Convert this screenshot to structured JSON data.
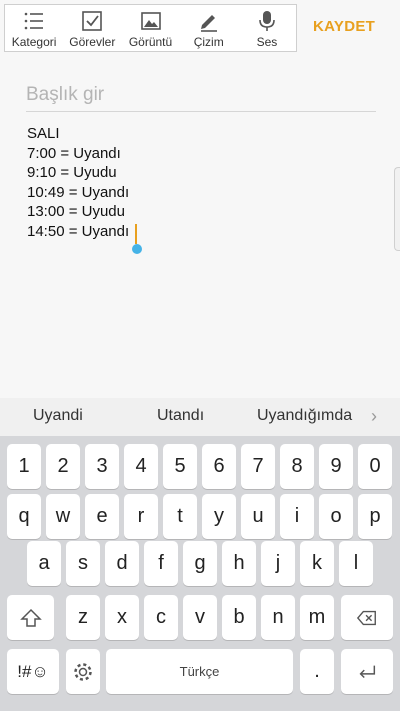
{
  "toolbar": {
    "items": [
      {
        "label": "Kategori",
        "icon": "category-list-icon"
      },
      {
        "label": "Görevler",
        "icon": "checkbox-icon"
      },
      {
        "label": "Görüntü",
        "icon": "image-icon"
      },
      {
        "label": "Çizim",
        "icon": "pen-icon"
      },
      {
        "label": "Ses",
        "icon": "microphone-icon"
      }
    ],
    "save_label": "KAYDET"
  },
  "editor": {
    "title_placeholder": "Başlık gir",
    "body_lines": [
      "SALI",
      "7:00 = Uyandı",
      "9:10 = Uyudu",
      "10:49 = Uyandı",
      "13:00 = Uyudu",
      "14:50 = Uyandı"
    ]
  },
  "suggestions": [
    "Uyandi",
    "Utandı",
    "Uyandığımda"
  ],
  "keyboard": {
    "row_numbers": [
      "1",
      "2",
      "3",
      "4",
      "5",
      "6",
      "7",
      "8",
      "9",
      "0"
    ],
    "row_top": [
      "q",
      "w",
      "e",
      "r",
      "t",
      "y",
      "u",
      "i",
      "o",
      "p"
    ],
    "row_middle": [
      "a",
      "s",
      "d",
      "f",
      "g",
      "h",
      "j",
      "k",
      "l"
    ],
    "row_bottom": [
      "z",
      "x",
      "c",
      "v",
      "b",
      "n",
      "m"
    ],
    "symbols_label": "!#☺",
    "space_label": "Türkçe",
    "period_label": "."
  },
  "colors": {
    "accent": "#e8a01f",
    "cursor_handle": "#45b3e7",
    "keyboard_bg": "#d5d6d9"
  }
}
